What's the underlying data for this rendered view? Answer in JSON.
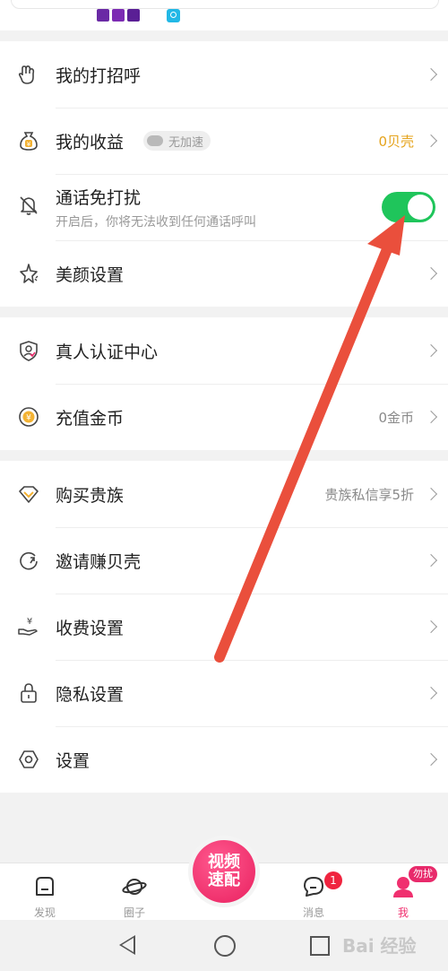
{
  "menu_groups": [
    {
      "items": [
        {
          "label": "我的打招呼",
          "icon": "wave-hand-icon",
          "value": ""
        },
        {
          "label": "我的收益",
          "icon": "money-bag-icon",
          "tag": "无加速",
          "value": "0贝壳",
          "value_color": "#e5a31b"
        },
        {
          "label": "通话免打扰",
          "icon": "bell-mute-icon",
          "sublabel": "开启后，你将无法收到任何通话呼叫",
          "toggle": true
        },
        {
          "label": "美颜设置",
          "icon": "sparkle-star-icon",
          "value": ""
        }
      ]
    },
    {
      "items": [
        {
          "label": "真人认证中心",
          "icon": "shield-user-icon",
          "value": ""
        },
        {
          "label": "充值金币",
          "icon": "yen-coin-icon",
          "value": "0金币"
        }
      ]
    },
    {
      "items": [
        {
          "label": "购买贵族",
          "icon": "diamond-icon",
          "value": "贵族私信享5折"
        },
        {
          "label": "邀请赚贝壳",
          "icon": "refresh-arrow-icon",
          "value": ""
        },
        {
          "label": "收费设置",
          "icon": "hand-money-icon",
          "value": ""
        },
        {
          "label": "隐私设置",
          "icon": "lock-icon",
          "value": ""
        },
        {
          "label": "设置",
          "icon": "hexagon-gear-icon",
          "value": ""
        }
      ]
    }
  ],
  "tabbar": {
    "tabs": [
      {
        "label": "发现",
        "icon": "discover-icon"
      },
      {
        "label": "圈子",
        "icon": "planet-icon"
      },
      {
        "label": "消息",
        "icon": "message-icon",
        "badge": "1"
      },
      {
        "label": "我",
        "icon": "user-icon",
        "badge": "勿扰",
        "active": true
      }
    ],
    "center_button": {
      "line1": "视频",
      "line2": "速配"
    }
  },
  "system_nav": {
    "back": "back-triangle-icon",
    "home": "home-circle-icon",
    "recent": "recent-square-icon"
  },
  "watermark": "Bai 经验",
  "colors": {
    "accent": "#f0306f",
    "toggle_on": "#1fc55b",
    "gold": "#e5a31b",
    "annotation_arrow": "#ea4f3c"
  }
}
